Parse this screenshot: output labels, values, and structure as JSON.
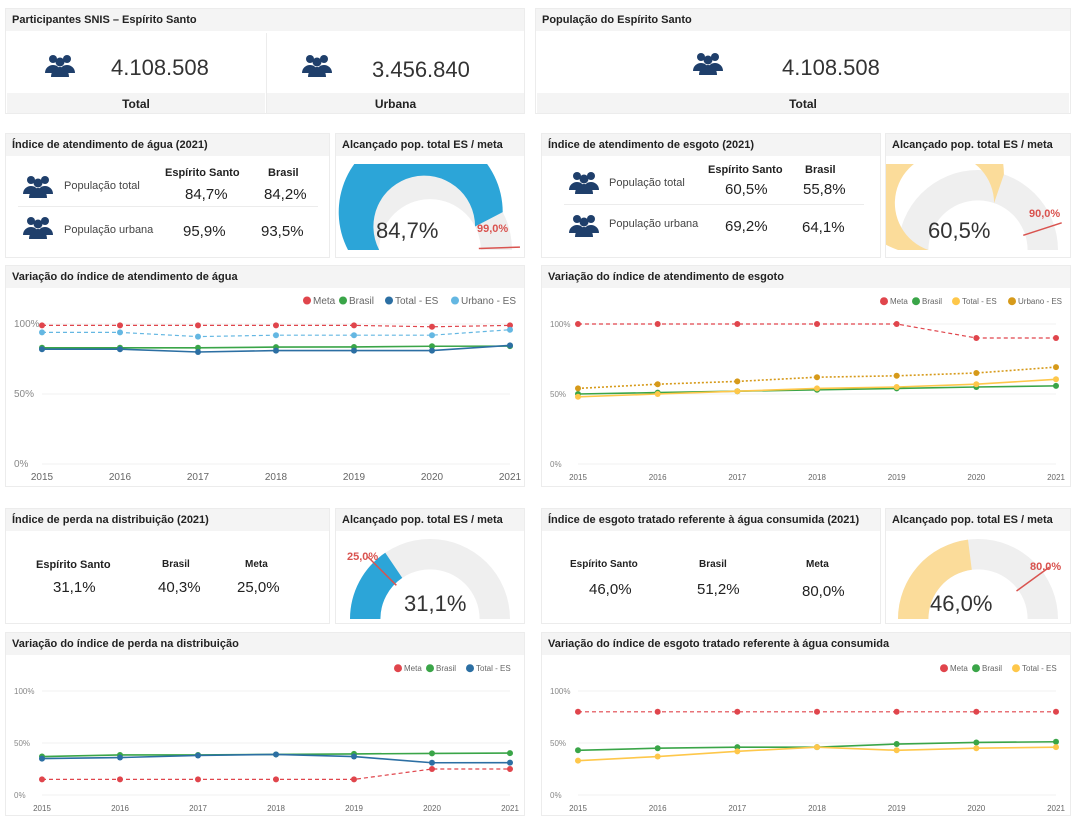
{
  "colors": {
    "meta": "#e0454c",
    "brasil": "#3aa548",
    "total": "#2c6fa3",
    "urbano": "#64b7e2",
    "gauge_agua": "#2ca5d8",
    "gauge_esgoto": "#fbdc9a",
    "icon": "#1f3f6b",
    "total_yellow": "#fec74a",
    "urbano_dark": "#d69a1a"
  },
  "snis": {
    "title": "Participantes SNIS – Espírito Santo",
    "total_value": "4.108.508",
    "total_label": "Total",
    "urbana_value": "3.456.840",
    "urbana_label": "Urbana"
  },
  "pop": {
    "title": "População do Espírito Santo",
    "value": "4.108.508",
    "label": "Total"
  },
  "agua": {
    "title": "Índice de atendimento de água (2021)",
    "col_es": "Espírito Santo",
    "col_br": "Brasil",
    "row1_label": "População total",
    "row1_es": "84,7%",
    "row1_br": "84,2%",
    "row2_label": "População urbana",
    "row2_es": "95,9%",
    "row2_br": "93,5%",
    "gauge_title": "Alcançado pop. total ES / meta",
    "gauge_value": "84,7%",
    "gauge_meta": "99,0%",
    "gauge_fraction": 0.847,
    "meta_fraction": 0.99
  },
  "esgoto": {
    "title": "Índice de atendimento de esgoto (2021)",
    "col_es": "Espírito Santo",
    "col_br": "Brasil",
    "row1_label": "População total",
    "row1_es": "60,5%",
    "row1_br": "55,8%",
    "row2_label": "População urbana",
    "row2_es": "69,2%",
    "row2_br": "64,1%",
    "gauge_title": "Alcançado pop. total ES / meta",
    "gauge_value": "60,5%",
    "gauge_meta": "90,0%",
    "gauge_fraction": 0.605,
    "meta_fraction": 0.9
  },
  "perda": {
    "title": "Índice de perda na distribuição (2021)",
    "col_es": "Espírito Santo",
    "col_br": "Brasil",
    "col_meta": "Meta",
    "val_es": "31,1%",
    "val_br": "40,3%",
    "val_meta": "25,0%",
    "gauge_title": "Alcançado pop. total ES / meta",
    "gauge_value": "31,1%",
    "gauge_meta": "25,0%",
    "gauge_fraction": 0.311,
    "meta_fraction": 0.25
  },
  "tratado": {
    "title": "Índice de esgoto tratado referente à água consumida (2021)",
    "col_es": "Espírito Santo",
    "col_br": "Brasil",
    "col_meta": "Meta",
    "val_es": "46,0%",
    "val_br": "51,2%",
    "val_meta": "80,0%",
    "gauge_title": "Alcançado pop. total ES / meta",
    "gauge_value": "46,0%",
    "gauge_meta": "80,0%",
    "gauge_fraction": 0.46,
    "meta_fraction": 0.8
  },
  "chart_data": [
    {
      "type": "line",
      "title": "Variação do índice de atendimento de água",
      "x": [
        "2015",
        "2016",
        "2017",
        "2018",
        "2019",
        "2020",
        "2021"
      ],
      "ylim": [
        0,
        100
      ],
      "yticks": [
        "0%",
        "50%",
        "100%"
      ],
      "legend": "top-right",
      "series": [
        {
          "name": "Meta",
          "color": "#e0454c",
          "dashed": true,
          "values": [
            99,
            99,
            99,
            99,
            99,
            98,
            99
          ]
        },
        {
          "name": "Brasil",
          "color": "#3aa548",
          "values": [
            83,
            83,
            83,
            83.5,
            83.6,
            84.1,
            84.2
          ]
        },
        {
          "name": "Total - ES",
          "color": "#2c6fa3",
          "values": [
            82,
            82,
            80,
            81,
            81,
            81,
            84.7
          ]
        },
        {
          "name": "Urbano - ES",
          "color": "#64b7e2",
          "dashed": true,
          "values": [
            94,
            94,
            91,
            92,
            92,
            92,
            95.9
          ]
        }
      ]
    },
    {
      "type": "line",
      "title": "Variação do índice de atendimento de esgoto",
      "x": [
        "2015",
        "2016",
        "2017",
        "2018",
        "2019",
        "2020",
        "2021"
      ],
      "ylim": [
        0,
        100
      ],
      "yticks": [
        "0%",
        "50%",
        "100%"
      ],
      "legend": "top-right",
      "series": [
        {
          "name": "Meta",
          "color": "#e0454c",
          "dashed": true,
          "values": [
            100,
            100,
            100,
            100,
            100,
            90,
            90
          ]
        },
        {
          "name": "Brasil",
          "color": "#3aa548",
          "values": [
            50,
            51,
            52,
            53,
            54,
            55,
            55.8
          ]
        },
        {
          "name": "Total - ES",
          "color": "#fec74a",
          "values": [
            48,
            50,
            52,
            54,
            55,
            57,
            60.5
          ]
        },
        {
          "name": "Urbano - ES",
          "color": "#d69a1a",
          "dotted": true,
          "values": [
            54,
            57,
            59,
            62,
            63,
            65,
            69.2
          ]
        }
      ]
    },
    {
      "type": "line",
      "title": "Variação do índice de perda na distribuição",
      "x": [
        "2015",
        "2016",
        "2017",
        "2018",
        "2019",
        "2020",
        "2021"
      ],
      "ylim": [
        0,
        100
      ],
      "yticks": [
        "0%",
        "50%",
        "100%"
      ],
      "legend": "top-right",
      "series": [
        {
          "name": "Meta",
          "color": "#e0454c",
          "dashed": true,
          "values": [
            15,
            15,
            15,
            15,
            15,
            25,
            25
          ]
        },
        {
          "name": "Brasil",
          "color": "#3aa548",
          "values": [
            37,
            38.5,
            38.5,
            39,
            39.5,
            40,
            40.3
          ]
        },
        {
          "name": "Total - ES",
          "color": "#2c6fa3",
          "values": [
            35,
            36,
            38,
            39,
            37,
            31,
            31.1
          ]
        }
      ]
    },
    {
      "type": "line",
      "title": "Variação do índice de esgoto tratado referente à água consumida",
      "x": [
        "2015",
        "2016",
        "2017",
        "2018",
        "2019",
        "2020",
        "2021"
      ],
      "ylim": [
        0,
        100
      ],
      "yticks": [
        "0%",
        "50%",
        "100%"
      ],
      "legend": "top-right",
      "series": [
        {
          "name": "Meta",
          "color": "#e0454c",
          "dashed": true,
          "values": [
            80,
            80,
            80,
            80,
            80,
            80,
            80
          ]
        },
        {
          "name": "Brasil",
          "color": "#3aa548",
          "values": [
            43,
            45,
            46,
            46,
            49,
            50.5,
            51.2
          ]
        },
        {
          "name": "Total - ES",
          "color": "#fec74a",
          "values": [
            33,
            37,
            42,
            46,
            43,
            45,
            46
          ]
        }
      ]
    }
  ]
}
